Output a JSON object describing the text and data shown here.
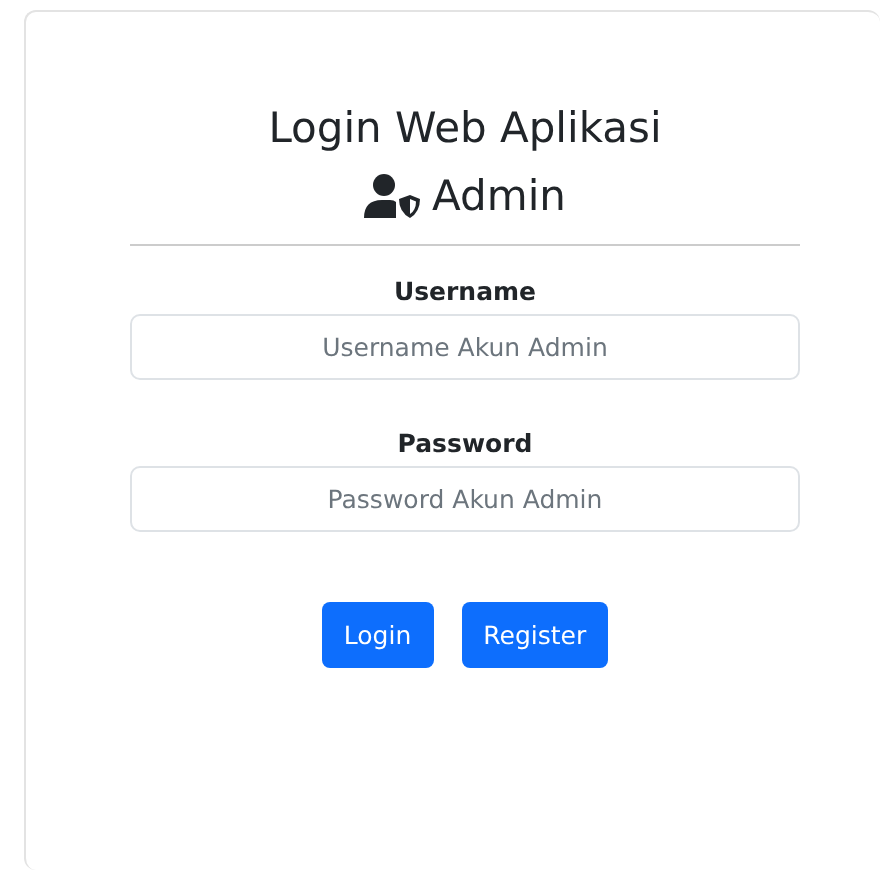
{
  "title": "Login Web Aplikasi",
  "subtitle": "Admin",
  "fields": [
    {
      "label": "Username",
      "placeholder": "Username Akun Admin"
    },
    {
      "label": "Password",
      "placeholder": "Password Akun Admin"
    }
  ],
  "buttons": [
    "Login",
    "Register"
  ]
}
